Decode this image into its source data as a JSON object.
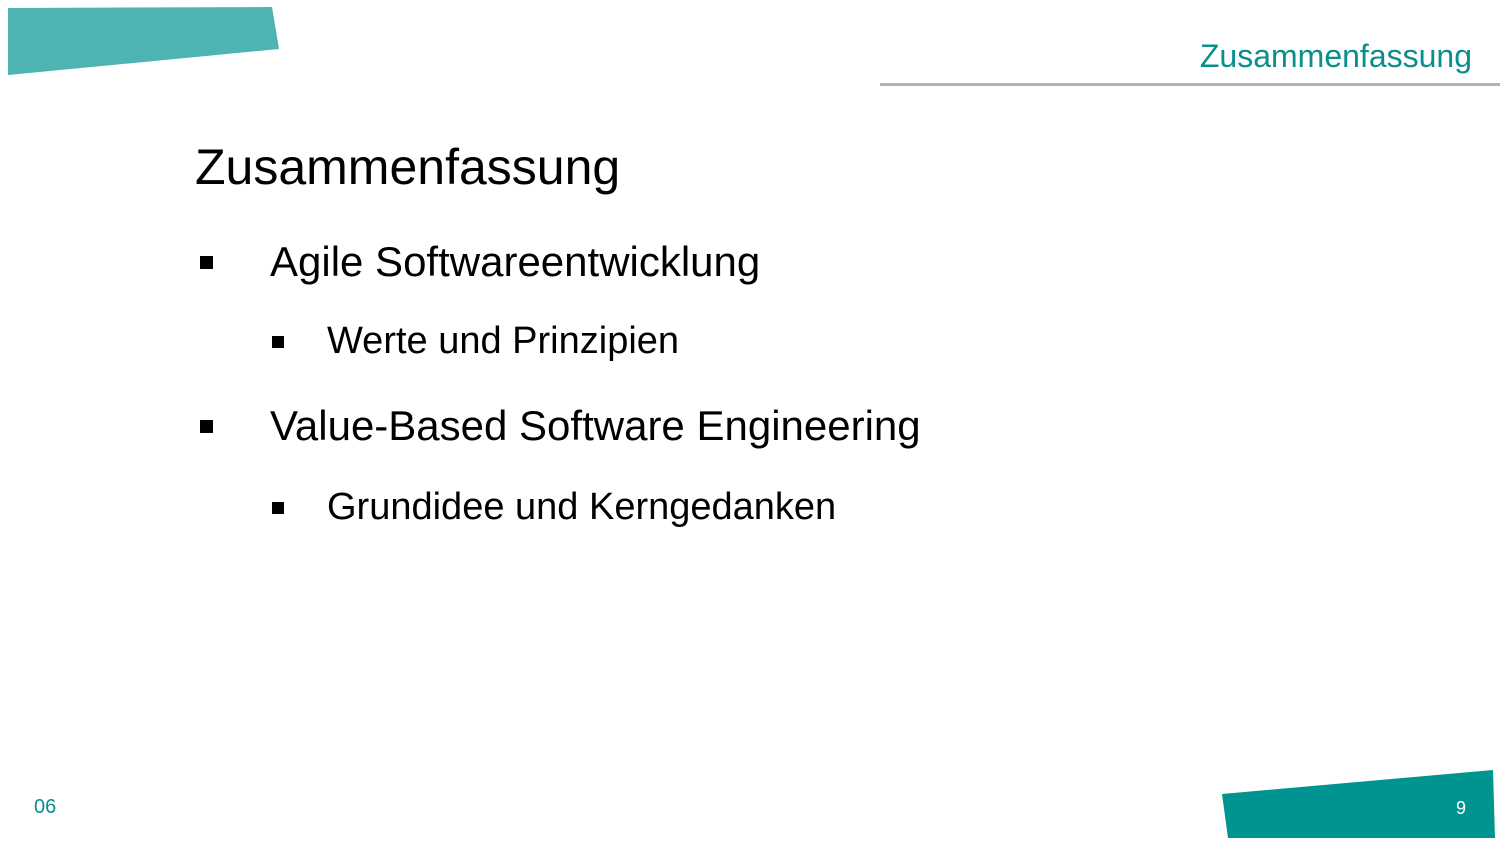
{
  "header": {
    "section_label": "Zusammenfassung"
  },
  "title": "Zusammenfassung",
  "bullets": [
    {
      "level": 1,
      "text": "Agile Softwareentwicklung"
    },
    {
      "level": 2,
      "text": "Werte und Prinzipien"
    },
    {
      "level": 1,
      "text": "Value-Based Software Engineering"
    },
    {
      "level": 2,
      "text": "Grundidee und Kerngedanken"
    }
  ],
  "footer": {
    "section_number": "06",
    "page_number": "9"
  },
  "colors": {
    "accent_light": "#4db3b3",
    "accent_dark": "#009490",
    "text_accent": "#0a8f8c",
    "rule": "#b3b3b3"
  }
}
